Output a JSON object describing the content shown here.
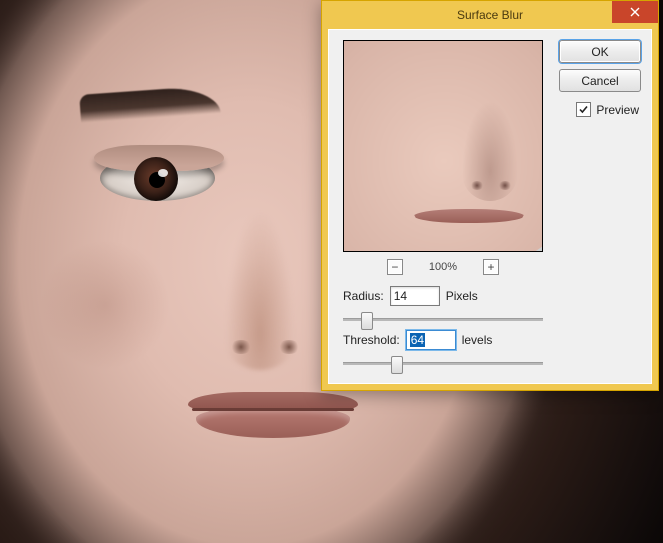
{
  "dialog": {
    "title": "Surface Blur",
    "ok_label": "OK",
    "cancel_label": "Cancel",
    "preview_label": "Preview",
    "preview_checked": true,
    "zoom_pct": "100%",
    "zoom_out_glyph": "−",
    "zoom_in_glyph": "+",
    "radius": {
      "label": "Radius:",
      "value": "14",
      "unit": "Pixels",
      "slider_pct": 12
    },
    "threshold": {
      "label": "Threshold:",
      "value": "64",
      "unit": "levels",
      "slider_pct": 27,
      "focused": true
    }
  },
  "colors": {
    "dialog_chrome": "#f0c850",
    "close_bg": "#c9452a",
    "focus_ring": "#3b8bd3",
    "selection_bg": "#0a63b3"
  }
}
